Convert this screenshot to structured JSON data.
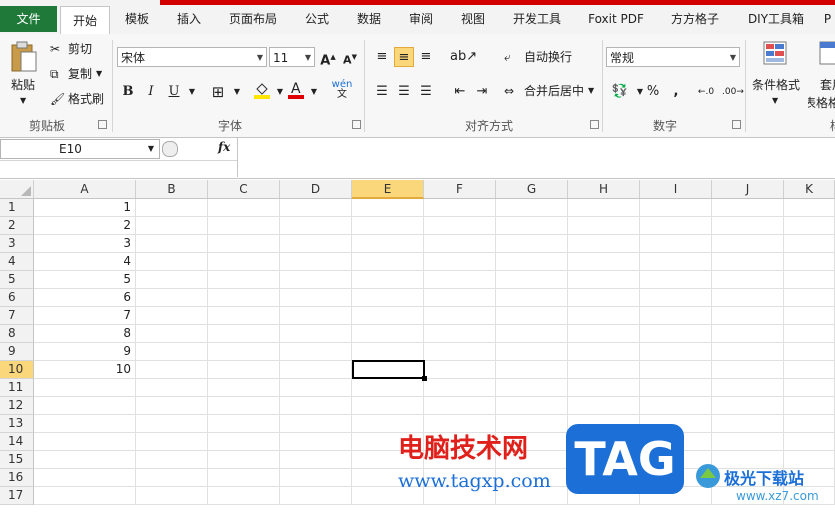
{
  "tabs": [
    {
      "label": "文件"
    },
    {
      "label": "开始"
    },
    {
      "label": "模板"
    },
    {
      "label": "插入"
    },
    {
      "label": "页面布局"
    },
    {
      "label": "公式"
    },
    {
      "label": "数据"
    },
    {
      "label": "审阅"
    },
    {
      "label": "视图"
    },
    {
      "label": "开发工具"
    },
    {
      "label": "Foxit PDF"
    },
    {
      "label": "方方格子"
    },
    {
      "label": "DIY工具箱"
    },
    {
      "label": "P"
    }
  ],
  "clipboard": {
    "paste": "粘贴",
    "cut": "剪切",
    "copy": "复制",
    "format_painter": "格式刷",
    "group": "剪贴板"
  },
  "font": {
    "name": "宋体",
    "size": "11",
    "bold": "B",
    "italic": "I",
    "underline": "U",
    "wen": "wén",
    "group": "字体"
  },
  "alignment": {
    "wrap": "自动换行",
    "merge": "合并后居中",
    "group": "对齐方式"
  },
  "number": {
    "format": "常规",
    "percent": "%",
    "comma": ",",
    "group": "数字"
  },
  "styles": {
    "conditional": "条件格式",
    "table_fmt_1": "套用",
    "table_fmt_2": "表格格",
    "group": "样"
  },
  "formula_bar": {
    "name_box": "E10",
    "fx": "fx",
    "formula": ""
  },
  "columns": [
    "A",
    "B",
    "C",
    "D",
    "E",
    "F",
    "G",
    "H",
    "I",
    "J",
    "K"
  ],
  "selected_column": "E",
  "selected_row": "10",
  "rows": [
    "1",
    "2",
    "3",
    "4",
    "5",
    "6",
    "7",
    "8",
    "9",
    "10",
    "11",
    "12",
    "13",
    "14",
    "15",
    "16",
    "17"
  ],
  "column_a_values": [
    "1",
    "2",
    "3",
    "4",
    "5",
    "6",
    "7",
    "8",
    "9",
    "10",
    "",
    "",
    "",
    "",
    "",
    "",
    ""
  ],
  "watermark": {
    "site": "电脑技术网",
    "url": "www.tagxp.com",
    "tag": "TAG",
    "brand": "极光下载站",
    "brand_url": "www.xz7.com"
  },
  "colors": {
    "file_tab": "#1f7a3a",
    "selection": "#fbd77c",
    "watermark_red": "#e0211b",
    "watermark_blue": "#1b6fd6"
  }
}
